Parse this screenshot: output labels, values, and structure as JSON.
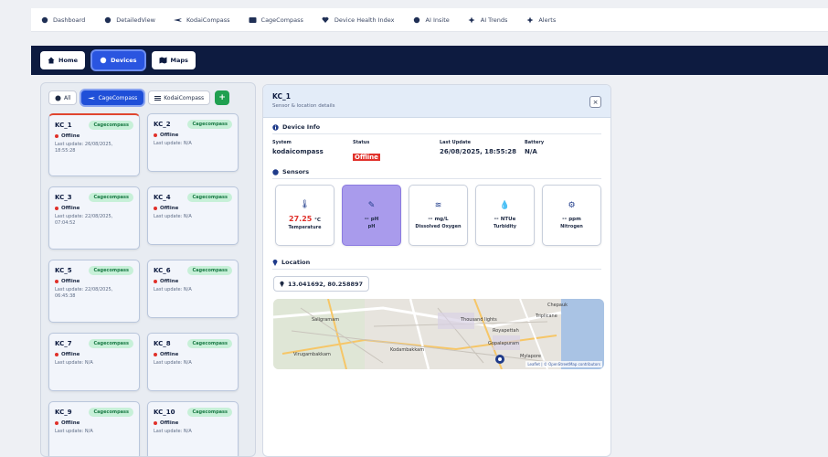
{
  "topnav": [
    {
      "label": "Dashboard",
      "icon": "dashboard-icon"
    },
    {
      "label": "DetailedView",
      "icon": "detailedview-icon"
    },
    {
      "label": "KodaiCompass",
      "icon": "kodaicompass-icon"
    },
    {
      "label": "CageCompass",
      "icon": "cagecompass-icon"
    },
    {
      "label": "Device Health Index",
      "icon": "health-icon"
    },
    {
      "label": "AI Insite",
      "icon": "ai-insite-icon"
    },
    {
      "label": "AI Trends",
      "icon": "ai-trends-icon"
    },
    {
      "label": "Alerts",
      "icon": "alerts-icon"
    }
  ],
  "header": {
    "home": "Home",
    "devices": "Devices",
    "maps": "Maps"
  },
  "filters": {
    "all": "All",
    "cage": "CageCompass",
    "kodai": "KodaiCompass",
    "add": "+"
  },
  "devices": [
    {
      "name": "KC_1",
      "badge": "Cagecompass",
      "status": "Offline",
      "updated": "Last update: 26/08/2025, 18:55:28"
    },
    {
      "name": "KC_2",
      "badge": "Cagecompass",
      "status": "Offline",
      "updated": "Last update: N/A"
    },
    {
      "name": "KC_3",
      "badge": "Cagecompass",
      "status": "Offline",
      "updated": "Last update: 22/08/2025, 07:04:52"
    },
    {
      "name": "KC_4",
      "badge": "Cagecompass",
      "status": "Offline",
      "updated": "Last update: N/A"
    },
    {
      "name": "KC_5",
      "badge": "Cagecompass",
      "status": "Offline",
      "updated": "Last update: 22/08/2025, 06:45:38"
    },
    {
      "name": "KC_6",
      "badge": "Cagecompass",
      "status": "Offline",
      "updated": "Last update: N/A"
    },
    {
      "name": "KC_7",
      "badge": "Cagecompass",
      "status": "Offline",
      "updated": "Last update: N/A"
    },
    {
      "name": "KC_8",
      "badge": "Cagecompass",
      "status": "Offline",
      "updated": "Last update: N/A"
    },
    {
      "name": "KC_9",
      "badge": "Cagecompass",
      "status": "Offline",
      "updated": "Last update: N/A"
    },
    {
      "name": "KC_10",
      "badge": "Cagecompass",
      "status": "Offline",
      "updated": "Last update: N/A"
    }
  ],
  "detail": {
    "title": "KC_1",
    "subtitle": "Sensor & location details",
    "close": "×",
    "device_info_title": "Device Info",
    "info": {
      "system_label": "System",
      "system_value": "kodaicompass",
      "status_label": "Status",
      "status_value": "Offline",
      "update_label": "Last Update",
      "update_value": "26/08/2025, 18:55:28",
      "battery_label": "Battery",
      "battery_value": "N/A"
    },
    "sensors_title": "Sensors",
    "sensors": [
      {
        "value": "27.25",
        "unit": "°C",
        "label": "Temperature",
        "icon": "thermometer-icon"
      },
      {
        "value": "--",
        "unit": "pH",
        "label": "pH",
        "icon": "ph-icon"
      },
      {
        "value": "--",
        "unit": "mg/L",
        "label": "Dissolved Oxygen",
        "icon": "oxygen-icon"
      },
      {
        "value": "--",
        "unit": "NTUe",
        "label": "Turbidity",
        "icon": "turbidity-icon"
      },
      {
        "value": "--",
        "unit": "ppm",
        "label": "Nitrogen",
        "icon": "nitrogen-icon"
      }
    ],
    "location_title": "Location",
    "coordinates": "13.041692, 80.258897",
    "map_labels": {
      "a": "Saligramam",
      "b": "Kodambakkam",
      "c": "Thousand lights",
      "d": "Royapettah",
      "e": "Gopalapuram",
      "f": "Mylapore",
      "g": "Virugambakkam",
      "h": "Triplicane",
      "i": "Chepauk"
    },
    "map_attribution": "Leaflet | © OpenStreetMap contributors"
  },
  "colors": {
    "accent": "#1f4fd8",
    "navy": "#0d1b40",
    "offline": "#e0302a",
    "badge": "#c7f0d8",
    "selected_sensor": "#a99bec"
  }
}
